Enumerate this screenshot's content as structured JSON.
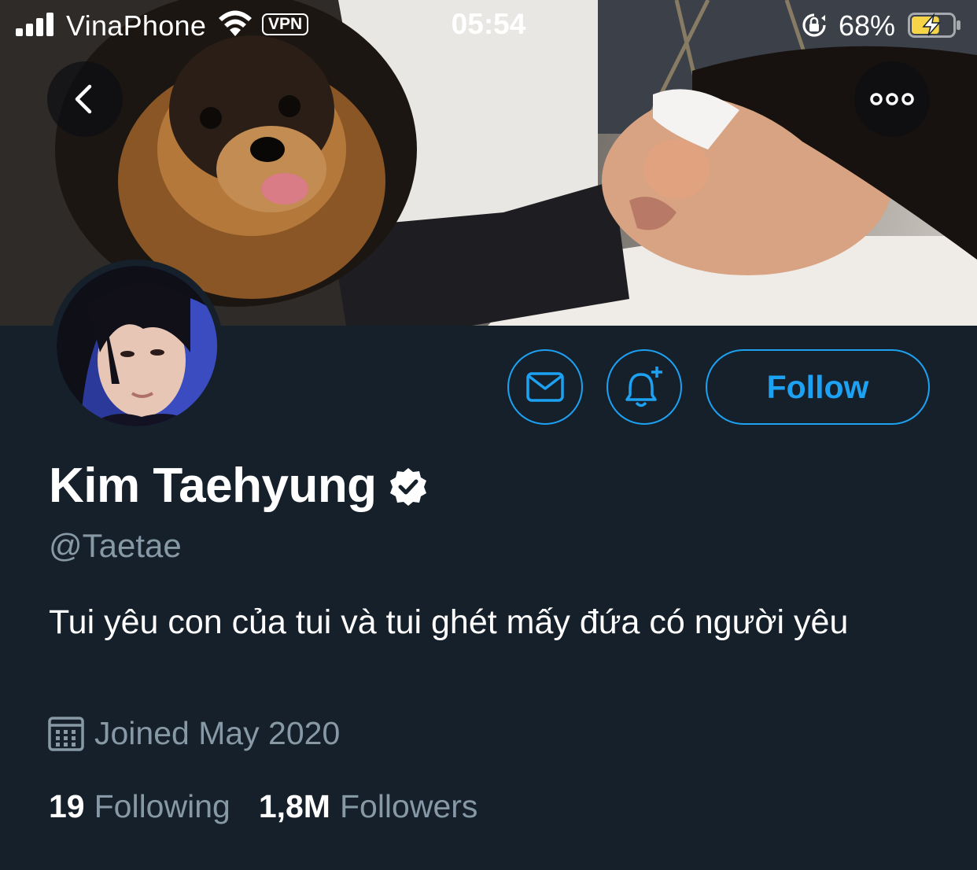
{
  "status_bar": {
    "carrier": "VinaPhone",
    "vpn": "VPN",
    "time": "05:54",
    "battery": "68%",
    "battery_level": 0.68,
    "signal_bars": 4
  },
  "banner": {
    "back_icon": "chevron-left-icon",
    "more_icon": "more-horizontal-icon"
  },
  "actions": {
    "message_icon": "envelope-icon",
    "notify_icon": "bell-plus-icon",
    "follow_label": "Follow"
  },
  "profile": {
    "display_name": "Kim Taehyung",
    "verified": true,
    "handle": "@Taetae",
    "bio": "Tui yêu con của tui và tui ghét mấy đứa có người yêu",
    "joined": "Joined May 2020",
    "following_count": "19",
    "following_label": "Following",
    "followers_count": "1,8M",
    "followers_label": "Followers"
  },
  "colors": {
    "background": "#15202b",
    "accent": "#1da1f2",
    "secondary_text": "#8899a6",
    "battery_fill": "#f5d547"
  }
}
